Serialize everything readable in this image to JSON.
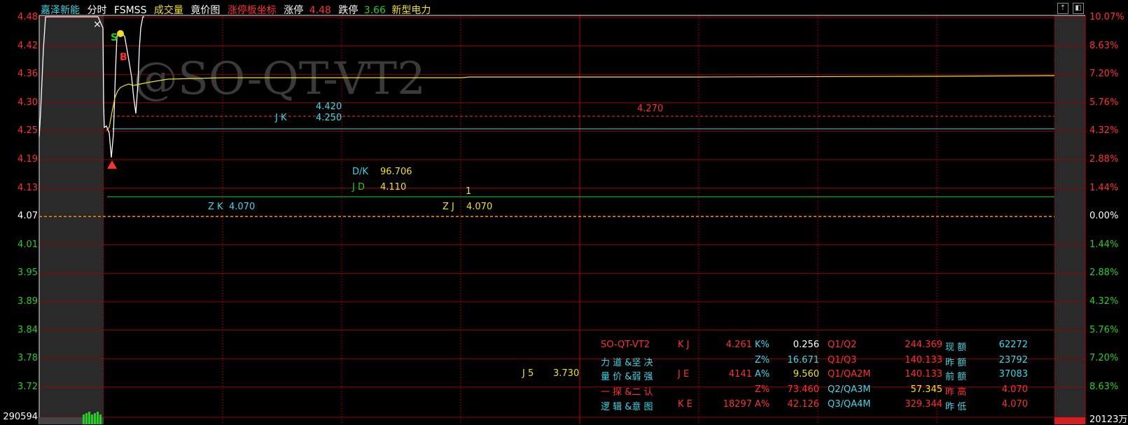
{
  "header": {
    "stock_name": "嘉泽新能",
    "tab_intraday": "分时",
    "tab_fsmss": "FSMSS",
    "tab_volume": "成交量",
    "tab_auction": "竟价图",
    "tab_limit_coord": "涨停板坐标",
    "limit_up_label": "涨停",
    "limit_up_value": "4.48",
    "limit_down_label": "跌停",
    "limit_down_value": "3.66",
    "sector": "新型电力"
  },
  "colors": {
    "red": "#ff3030",
    "green": "#22d022",
    "cyan": "#3cd8e8",
    "yellow": "#f0e020",
    "white": "#ffffff",
    "orange": "#ff8a00",
    "grid": "#9a0000",
    "tint": "#333333"
  },
  "left_axis": [
    "4.48",
    "4.42",
    "4.36",
    "4.30",
    "4.25",
    "4.19",
    "4.13",
    "4.07",
    "4.01",
    "3.95",
    "3.89",
    "3.84",
    "3.78",
    "3.72"
  ],
  "right_axis": [
    "10.07%",
    "8.63%",
    "7.20%",
    "5.76%",
    "4.32%",
    "2.88%",
    "1.44%",
    "0.00%",
    "1.44%",
    "2.88%",
    "4.32%",
    "5.76%",
    "7.20%",
    "8.63%"
  ],
  "bottom_left_value": "290594",
  "bottom_right_value": "20123万",
  "watermark": "@SO-QT-VT2",
  "close_glyph": "×",
  "annotations": {
    "jk_label": "J K",
    "jk_upper": "4.420",
    "jk_value": "4.250",
    "red_level": "4.270",
    "dk_label": "D/K",
    "dk_value": "96.706",
    "jd_label": "J D",
    "jd_value": "4.110",
    "marker_1": "1",
    "zk_label": "Z K",
    "zk_value": "4.070",
    "zj_label": "Z J",
    "zj_value": "4.070",
    "j5_label": "J 5",
    "j5_value": "3.730",
    "s_marker": "S",
    "b_marker": "B"
  },
  "table": {
    "r1": [
      "SO-QT-VT2",
      "K J",
      "4.261",
      "K%",
      "0.256",
      "Q1/Q2",
      "244.369",
      "现 额",
      "62272"
    ],
    "r2": [
      "力 道 &坚 决",
      "",
      "",
      "Z%",
      "16.671",
      "Q1/Q3",
      "140.133",
      "昨 额",
      "23792"
    ],
    "r3": [
      "量 价 &弱 强",
      "J E",
      "4141",
      "A%",
      "9.560",
      "Q1/QA2M",
      "140.133",
      "前 额",
      "37083"
    ],
    "r4": [
      "一 探 &二 认",
      "",
      "",
      "Z%",
      "73.460",
      "Q2/QA3M",
      "57.345",
      "昨 高",
      "4.070"
    ],
    "r5": [
      "逻 辑 &意 图",
      "K E",
      "18297",
      "A%",
      "42.126",
      "Q3/QA4M",
      "329.344",
      "昨 低",
      "4.070"
    ]
  }
}
